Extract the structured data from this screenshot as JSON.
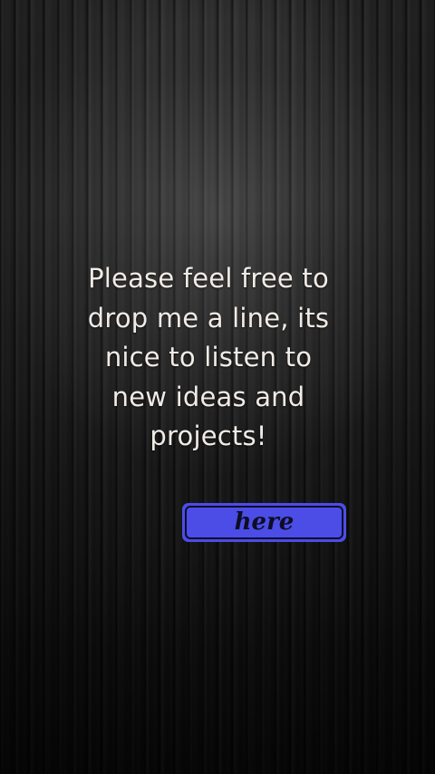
{
  "message": {
    "lines": [
      "Please feel free to",
      "drop me a line, its",
      "nice to listen to",
      "new ideas and",
      "projects!"
    ]
  },
  "button": {
    "label": "here"
  },
  "colors": {
    "text": "#f1ebe6",
    "button_fill": "#4b4de6",
    "button_border": "#0d0d2a",
    "button_text": "#0d0d24",
    "background": "#1c1c1c"
  }
}
